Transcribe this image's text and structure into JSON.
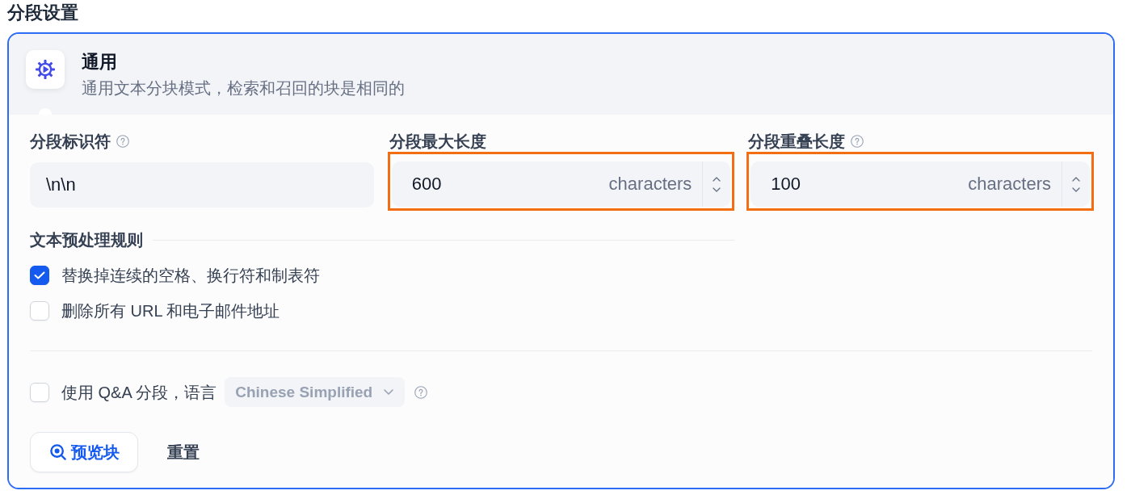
{
  "section_title": "分段设置",
  "mode_card": {
    "title": "通用",
    "description": "通用文本分块模式，检索和召回的块是相同的",
    "selected": true
  },
  "fields": [
    {
      "kind": "text",
      "label": "分段标识符",
      "help": true,
      "value": "\\n\\n"
    },
    {
      "kind": "number",
      "label": "分段最大长度",
      "help": false,
      "value": "600",
      "unit": "characters",
      "highlighted": true
    },
    {
      "kind": "number",
      "label": "分段重叠长度",
      "help": true,
      "value": "100",
      "unit": "characters",
      "highlighted": true
    }
  ],
  "preprocessing": {
    "title": "文本预处理规则",
    "rules": [
      {
        "label": "替换掉连续的空格、换行符和制表符",
        "checked": true
      },
      {
        "label": "删除所有 URL 和电子邮件地址",
        "checked": false
      }
    ]
  },
  "qa": {
    "label": "使用 Q&A 分段，语言",
    "checked": false,
    "language": "Chinese Simplified",
    "disabled": true,
    "help": true
  },
  "actions": [
    {
      "kind": "primary",
      "label": "预览块"
    },
    {
      "kind": "plain",
      "label": "重置"
    }
  ]
}
